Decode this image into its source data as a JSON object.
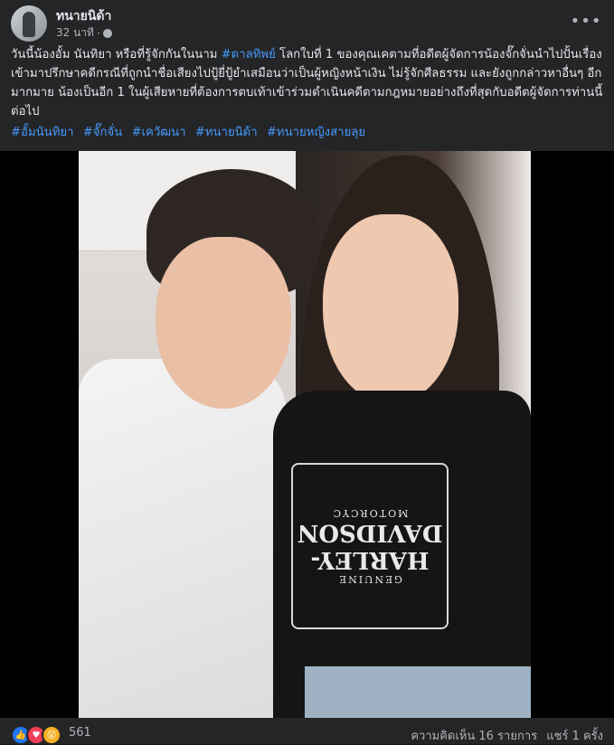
{
  "post": {
    "author": "ทนายนิด้า",
    "time": "32 นาที",
    "more_icon": "ellipsis-icon",
    "text_parts": [
      "วันนี้น้องอั้ม นันทิยา หรือที่รู้จักกันในนาม ",
      "#ดาลทิพย์",
      " โลกใบที่ 1 ของคุณเคตามที่อดีตผู้จัดการน้องจั๊กจั่นนำไปปั้นเรื่อง เข้ามาปรึกษาคดีกรณีที่ถูกนำชื่อเสียงไปปู้ยี่ปู้ยำเสมือนว่าเป็นผู้หญิงหน้าเงิน ไม่รู้จักศีลธรรม และยังถูกกล่าวหาอื่นๆ อีกมากมาย น้องเป็นอีก 1 ในผู้เสียหายที่ต้องการตบเท้าเข้าร่วมดำเนินคดีตามกฎหมายอย่างถึงที่สุดกับอดีตผู้จัดการท่านนี้ต่อไป"
    ],
    "hashtags": [
      "#อั้มนันทิยา",
      "#จั๊กจั่น",
      "#เควัฒนา",
      "#ทนายนิด้า",
      "#ทนายหญิงสายลุย"
    ]
  },
  "photo": {
    "shirt_text_top": "GENUINE",
    "shirt_text_main": "HARLEY-\nDAVIDSON",
    "shirt_text_bottom": "MOTORCYC"
  },
  "footer": {
    "reaction_count": "561",
    "comments": "ความคิดเห็น 16 รายการ",
    "shares": "แชร์ 1 ครั้ง",
    "reactions": [
      "like-icon",
      "love-icon",
      "wow-icon"
    ]
  },
  "colors": {
    "background": "#242526",
    "link": "#4599ff",
    "text": "#e4e6eb",
    "secondary": "#b0b3b8"
  }
}
